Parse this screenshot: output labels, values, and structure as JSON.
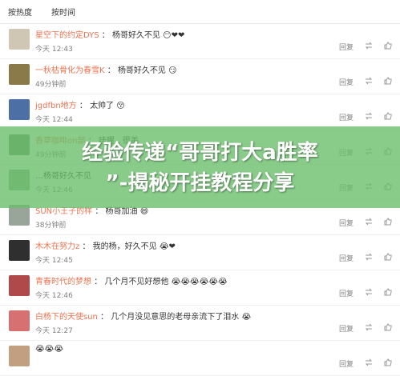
{
  "sort": {
    "hot": "按热度",
    "time": "按时间"
  },
  "actions": {
    "reply": "回复"
  },
  "comments": [
    {
      "user": "星空下的约定DYS",
      "text": "杨哥好久不见",
      "emoji": "😶❤❤",
      "time": "今天 12:43",
      "avatar_color": "#cfc6b3"
    },
    {
      "user": "一秋枯骨化为春雪K",
      "text": "杨哥好久不见",
      "emoji": "😏",
      "time": "49分钟前",
      "avatar_color": "#8a7a4a"
    },
    {
      "user": "jgdfbn地方",
      "text": "太帅了",
      "emoji": "😚",
      "time": "今天 12:44",
      "avatar_color": "#4c6fa5"
    },
    {
      "user": "香草咖啡on部",
      "text": "哇喔，很美",
      "emoji": "",
      "time": "49分钟前",
      "avatar_color": "#6c8f6c"
    },
    {
      "user": "",
      "text": "…杨哥好久不见",
      "emoji": "",
      "time": "今天 12:46",
      "avatar_color": "#8fb08f"
    },
    {
      "user": "SUN小王子的样",
      "text": "杨哥加油",
      "emoji": "😄",
      "time": "38分钟前",
      "avatar_color": "#9aa59a"
    },
    {
      "user": "木木在努力z",
      "text": "我的杨，好久不见",
      "emoji": "😭❤",
      "time": "今天 12:45",
      "avatar_color": "#2f2f2f"
    },
    {
      "user": "青春时代的梦想",
      "text": "几个月不见好想他",
      "emoji": "😭😭😭😭😭😭",
      "time": "今天 12:46",
      "avatar_color": "#b04a4a"
    },
    {
      "user": "白杨下的天使sun",
      "text": "几个月没见意思的老母亲流下了泪水",
      "emoji": "😭",
      "time": "今天 12:27",
      "avatar_color": "#d77070"
    },
    {
      "user": "",
      "text": "",
      "emoji": "😭😭😭",
      "time": "",
      "avatar_color": "#c0a080"
    }
  ],
  "overlay": {
    "line1": "经验传递“哥哥打大a胜率",
    "line2": "”-揭秘开挂教程分享"
  }
}
